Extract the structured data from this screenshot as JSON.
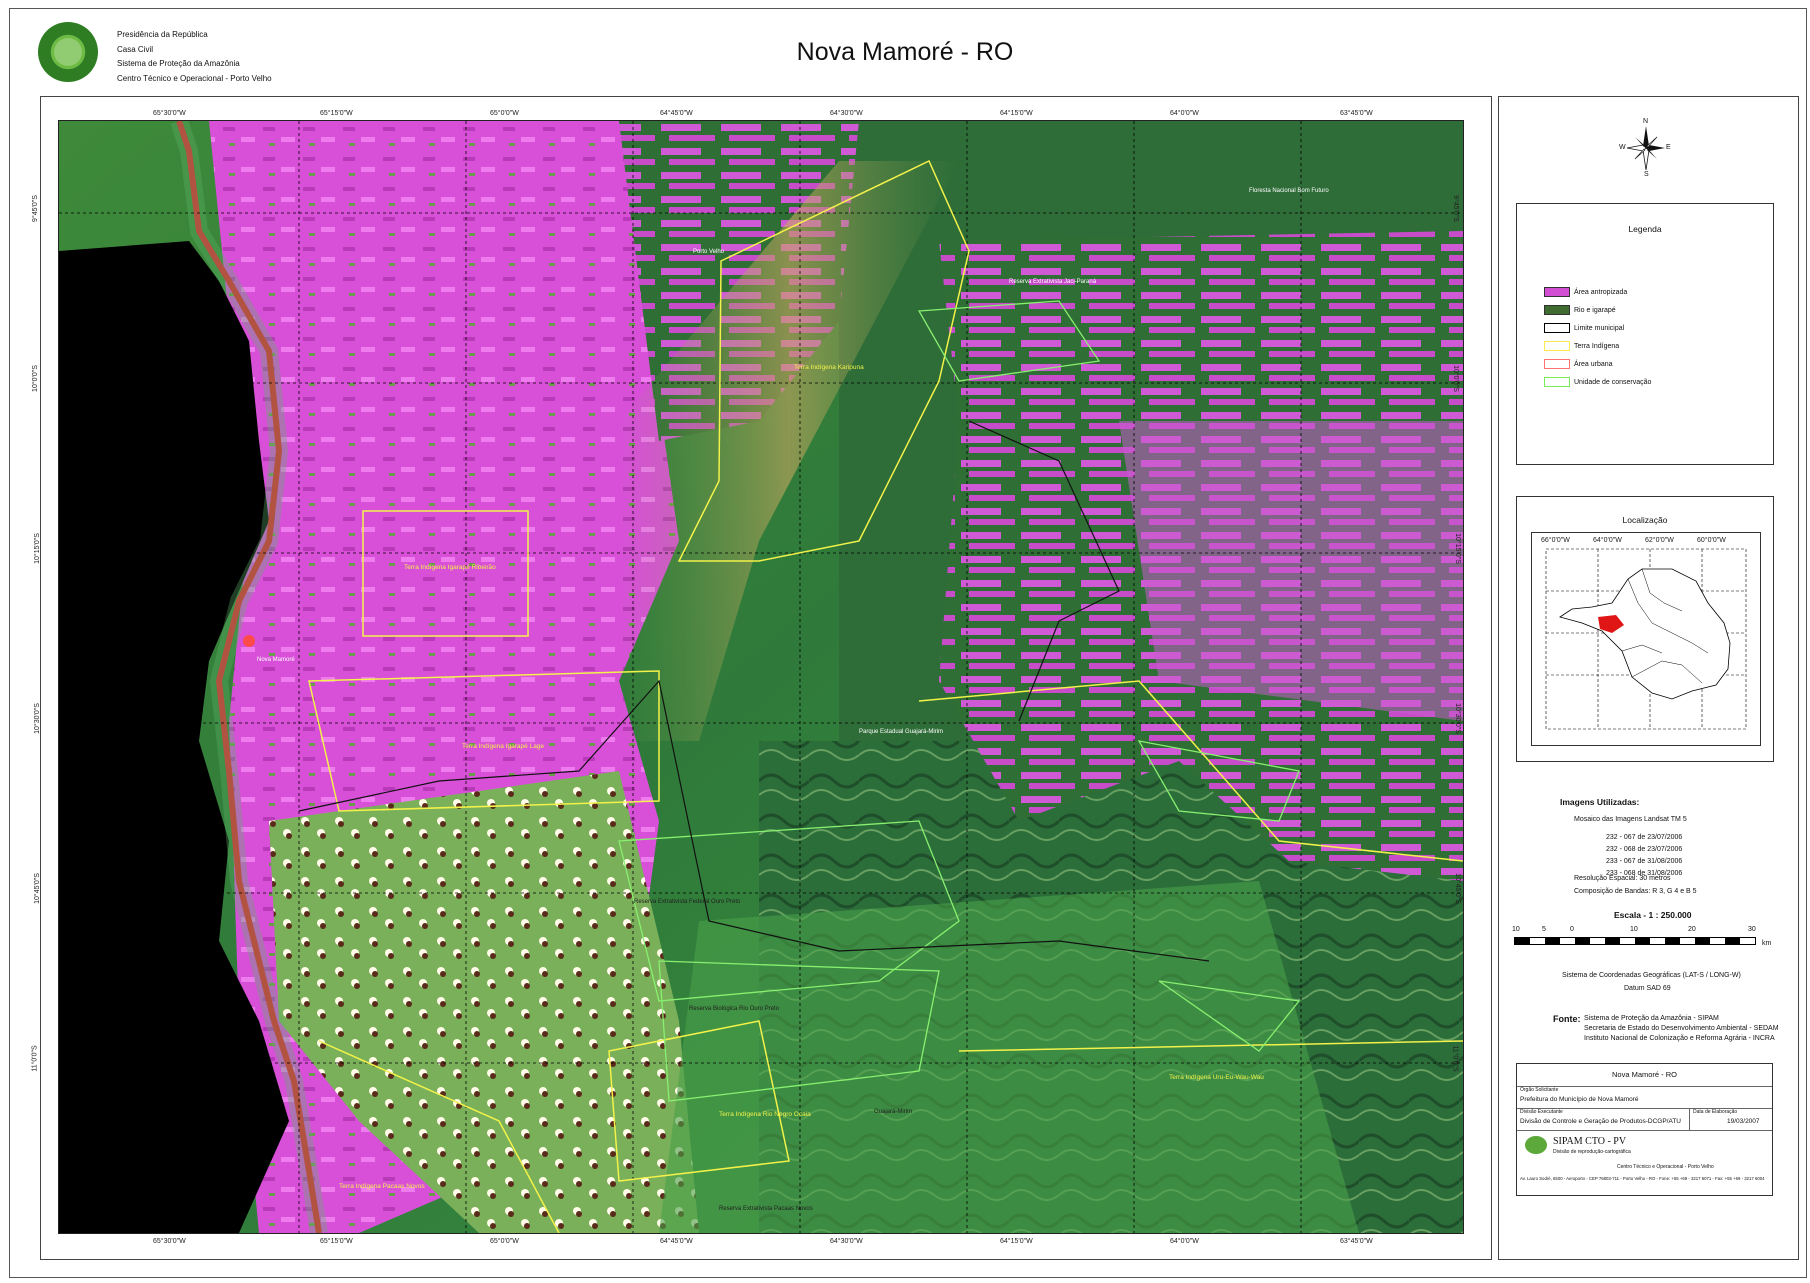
{
  "agency": {
    "lines": [
      "Presidência da República",
      "Casa Civil",
      "Sistema de Proteção da Amazônia",
      "Centro Técnico e Operacional - Porto Velho"
    ]
  },
  "title": "Nova Mamoré - RO",
  "map": {
    "lon_ticks": [
      "65°30'0\"W",
      "65°15'0\"W",
      "65°0'0\"W",
      "64°45'0\"W",
      "64°30'0\"W",
      "64°15'0\"W",
      "64°0'0\"W",
      "63°45'0\"W"
    ],
    "lat_ticks": [
      "9°45'0\"S",
      "10°0'0\"S",
      "10°15'0\"S",
      "10°30'0\"S",
      "10°45'0\"S",
      "11°0'0\"S"
    ],
    "labels": {
      "karipuna": "Terra Indígena Karipuna",
      "ribeirao": "Terra Indígena Igarapé Ribeirão",
      "lage": "Terra Indígena Igarapé Lage",
      "nova_mamore": "Nova Mamoré",
      "ouro_preto": "Reserva Extrativista Federal Ouro Preto",
      "bio_ouro_preto": "Reserva Biológica Rio Ouro Preto",
      "negro_ocaia": "Terra Indígena Rio Negro Ocaia",
      "pacaas_novos": "Terra Indígena Pacaas Novos",
      "resex_pacaas": "Reserva Extrativista Pacaas Novos",
      "uru_eu": "Terra Indígena Uru-Eu-Wau-Wau",
      "guajara": "Guajará-Mirim",
      "porto_velho": "Porto Velho",
      "jaci": "Reserva Extrativista Jaci-Paraná",
      "bom_futuro": "Floresta Nacional Bom Futuro",
      "rio_pacaas": "Parque Estadual Guajará-Mirim"
    }
  },
  "compass": {
    "n": "N",
    "s": "S",
    "e": "E",
    "w": "W"
  },
  "legend": {
    "title": "Legenda",
    "items": [
      {
        "label": "Área antropizada",
        "color": "#d24fd3"
      },
      {
        "label": "Rio e igarapé",
        "color": "#3f6b30"
      },
      {
        "label": "Limite municipal",
        "color": "#ffffff"
      },
      {
        "label": "Terra Indígena",
        "color": "#ffff55"
      },
      {
        "label": "Área urbana",
        "color": "#ff7070"
      },
      {
        "label": "Unidade de conservação",
        "color": "#77ee55"
      }
    ]
  },
  "location": {
    "title": "Localização",
    "lon_ticks": [
      "66°0'0\"W",
      "64°0'0\"W",
      "62°0'0\"W",
      "60°0'0\"W"
    ],
    "lat_ticks": [
      "8°0'0\"S",
      "10°0'0\"S",
      "12°0'0\"S",
      "14°0'0\"S"
    ]
  },
  "images": {
    "title": "Imagens Utilizadas:",
    "mosaic": "Mosaico das Imagens Landsat TM 5",
    "scenes": [
      "232 - 067 de 23/07/2006",
      "232 - 068 de 23/07/2006",
      "233 - 067 de 31/08/2006",
      "233 - 068 de 31/08/2006"
    ],
    "resolution": "Resolução Espacial: 30 metros",
    "bands": "Composição de Bandas: R 3, G 4 e B 5"
  },
  "scale": {
    "title": "Escala - 1 : 250.000",
    "marks": [
      "10",
      "5",
      "0",
      "10",
      "20",
      "30"
    ],
    "unit": "km"
  },
  "coords": {
    "system": "Sistema de Coordenadas Geográficas (LAT-S / LONG-W)",
    "datum": "Datum SAD 69"
  },
  "source": {
    "label": "Fonte:",
    "items": [
      "Sistema de Proteção da Amazônia - SIPAM",
      "Secretaria de Estado do Desenvolvimento Ambiental - SEDAM",
      "Instituto Nacional de Colonização e Reforma Agrária - INCRA"
    ]
  },
  "table": {
    "title": "Nova Mamoré - RO",
    "org_label": "Órgão Solicitante",
    "org_value": "Prefeitura do Município de Nova Mamoré",
    "div_label": "Divisão Executante",
    "div_value": "Divisão de Controle e Geração de Produtos-DCGP/ATU",
    "date_label": "Data de Elaboração",
    "date_value": "19/03/2007",
    "brand": "SIPAM CTO - PV",
    "brand_sub": "Divisão de reprodução-cartográfica",
    "center": "Centro Técnico e Operacional - Porto Velho",
    "address": "Av. Lauro Sodré, 6500 - Aeroporto - CEP 76803-711 - Porto Velho - RO - Fone: +55 +69 - 3217 6071 - Fax: +55 +69 - 3217 6004"
  }
}
